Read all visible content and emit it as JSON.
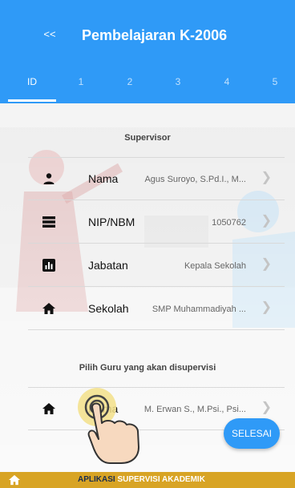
{
  "appbar": {
    "back_label": "<<",
    "title": "Pembelajaran K-2006",
    "tabs": [
      {
        "label": "ID",
        "active": true
      },
      {
        "label": "1",
        "active": false
      },
      {
        "label": "2",
        "active": false
      },
      {
        "label": "3",
        "active": false
      },
      {
        "label": "4",
        "active": false
      },
      {
        "label": "5",
        "active": false
      }
    ]
  },
  "supervisor": {
    "header": "Supervisor",
    "rows": [
      {
        "icon": "person-icon",
        "label": "Nama",
        "value": "Agus Suroyo, S.Pd.I., M..."
      },
      {
        "icon": "list-icon",
        "label": "NIP/NBM",
        "value": "1050762"
      },
      {
        "icon": "bar-chart-icon",
        "label": "Jabatan",
        "value": "Kepala Sekolah"
      },
      {
        "icon": "home-icon",
        "label": "Sekolah",
        "value": "SMP Muhammadiyah ..."
      }
    ]
  },
  "guru": {
    "header": "Pilih Guru yang akan disupervisi",
    "row": {
      "icon": "home-icon",
      "label": "Nama",
      "value": "M. Erwan S., M.Psi., Psi..."
    }
  },
  "fab": {
    "label": "SELESAI"
  },
  "footer": {
    "brand_part1": "APLIKASI",
    "brand_part2": "SUPERVISI AKADEMIK"
  },
  "colors": {
    "primary": "#2f9af7",
    "footer": "#d8a425",
    "chevron": "#c4c4c4"
  }
}
